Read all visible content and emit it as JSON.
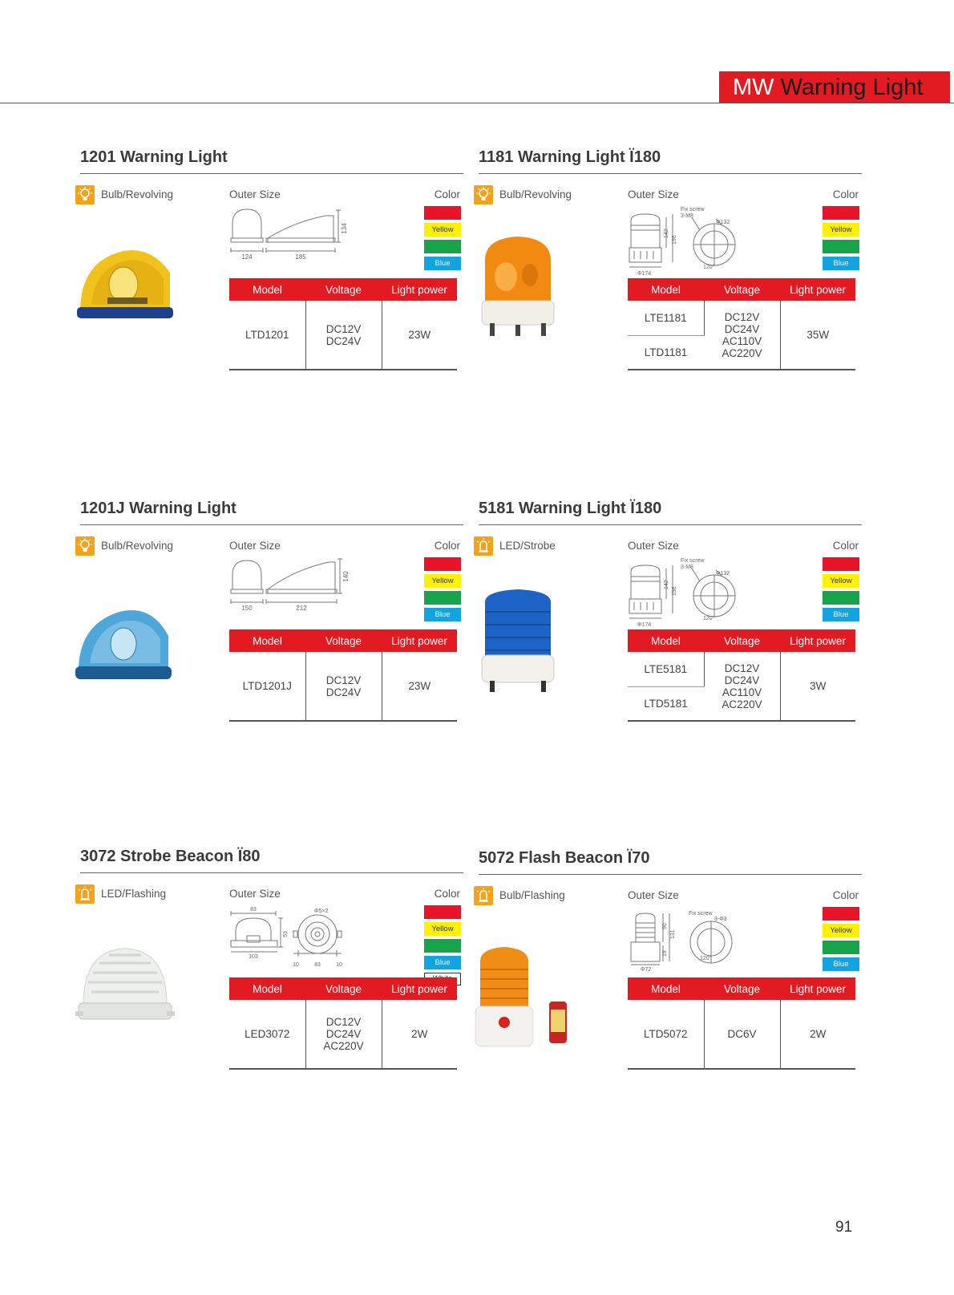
{
  "header": {
    "title_word1": "MW",
    "title_word2": "Warning Light"
  },
  "labels": {
    "outer_size": "Outer Size",
    "color": "Color"
  },
  "table_headers": {
    "model": "Model",
    "voltage": "Voltage",
    "light_power": "Light power"
  },
  "colors": {
    "accent_red": "#e21b23",
    "icon_orange": "#f5a21b",
    "swatch_red": "#e8142a",
    "swatch_yellow": "#fff200",
    "swatch_green": "#16a34a",
    "swatch_blue": "#12a4e0"
  },
  "products": [
    {
      "title": "1201 Warning Light",
      "type": "Bulb/Revolving",
      "type_icon": "bulb-icon",
      "swatches": [
        "Red",
        "Yellow",
        "Green",
        "Blue"
      ],
      "dimensions": {
        "width_a": "124",
        "width_b": "185",
        "height": "134"
      },
      "models": [
        "LTD1201"
      ],
      "voltages": [
        "DC12V",
        "DC24V"
      ],
      "power": "23W"
    },
    {
      "title": "1181 Warning Light Ï180",
      "type": "Bulb/Revolving",
      "type_icon": "bulb-icon",
      "swatches": [
        "Red",
        "Yellow",
        "Green",
        "Blue"
      ],
      "dimensions": {
        "fix_screw": "Fix screw",
        "screw_size": "3-M8",
        "bolt_circle": "Φ132",
        "h1": "142",
        "h2": "196",
        "angle": "120°",
        "base": "Φ174"
      },
      "models": [
        "LTE1181",
        "LTD1181"
      ],
      "voltages": [
        "DC12V",
        "DC24V",
        "AC110V",
        "AC220V"
      ],
      "power": "35W"
    },
    {
      "title": "1201J Warning Light",
      "type": "Bulb/Revolving",
      "type_icon": "bulb-icon",
      "swatches": [
        "Red",
        "Yellow",
        "Green",
        "Blue"
      ],
      "dimensions": {
        "width_a": "150",
        "width_b": "212",
        "height": "140"
      },
      "models": [
        "LTD1201J"
      ],
      "voltages": [
        "DC12V",
        "DC24V"
      ],
      "power": "23W"
    },
    {
      "title": "5181 Warning Light Ï180",
      "type": "LED/Strobe",
      "type_icon": "led-icon",
      "swatches": [
        "Red",
        "Yellow",
        "Green",
        "Blue"
      ],
      "dimensions": {
        "fix_screw": "Fix screw",
        "screw_size": "3-M8",
        "bolt_circle": "Φ132",
        "h1": "142",
        "h2": "196",
        "angle": "120°",
        "base": "Φ174"
      },
      "models": [
        "LTE5181",
        "LTD5181"
      ],
      "voltages": [
        "DC12V",
        "DC24V",
        "AC110V",
        "AC220V"
      ],
      "power": "3W"
    },
    {
      "title": "3072 Strobe Beacon Ï80",
      "type": "LED/Flashing",
      "type_icon": "led-icon",
      "swatches": [
        "Red",
        "Yellow",
        "Green",
        "Blue",
        "White"
      ],
      "dimensions": {
        "top": "83",
        "base": "103",
        "height": "53",
        "hole": "Φ5×2",
        "s1": "10",
        "s2": "83",
        "s3": "10"
      },
      "models": [
        "LED3072"
      ],
      "voltages": [
        "DC12V",
        "DC24V",
        "AC220V"
      ],
      "power": "2W"
    },
    {
      "title": "5072 Flash Beacon Ï70",
      "type": "Bulb/Flashing",
      "type_icon": "led-icon",
      "swatches": [
        "Red",
        "Yellow",
        "Green",
        "Blue"
      ],
      "dimensions": {
        "fix_screw": "Fix screw",
        "screw_size": "3-Φ3",
        "h1": "90",
        "h2": "131",
        "h3": "19",
        "angle": "120°",
        "base": "Φ72"
      },
      "models": [
        "LTD5072"
      ],
      "voltages": [
        "DC6V"
      ],
      "power": "2W"
    }
  ],
  "page_number": "91"
}
